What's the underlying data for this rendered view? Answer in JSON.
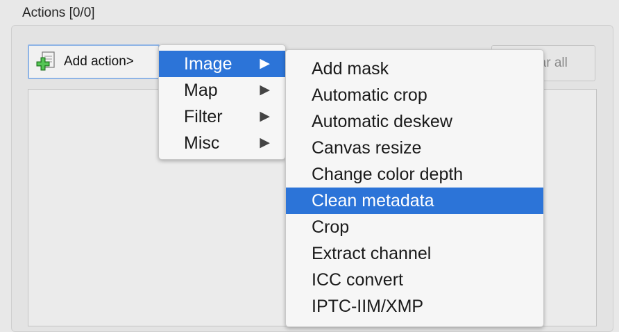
{
  "group": {
    "title": "Actions [0/0]"
  },
  "toolbar": {
    "add_action_label": "Add action>",
    "add_action_icon": "add-document-icon",
    "clear_all_label": "Clear all"
  },
  "menu": {
    "items": [
      {
        "label": "Image",
        "submenu_arrow": "▶",
        "highlighted": true
      },
      {
        "label": "Map",
        "submenu_arrow": "▶"
      },
      {
        "label": "Filter",
        "submenu_arrow": "▶"
      },
      {
        "label": "Misc",
        "submenu_arrow": "▶"
      }
    ]
  },
  "submenu": {
    "items": [
      {
        "label": "Add mask"
      },
      {
        "label": "Automatic crop"
      },
      {
        "label": "Automatic deskew"
      },
      {
        "label": "Canvas resize"
      },
      {
        "label": "Change color depth"
      },
      {
        "label": "Clean metadata",
        "highlighted": true
      },
      {
        "label": "Crop"
      },
      {
        "label": "Extract channel"
      },
      {
        "label": "ICC convert"
      },
      {
        "label": "IPTC-IIM/XMP"
      }
    ]
  },
  "colors": {
    "highlight": "#2c74d8",
    "button_focus_border": "#8eb4e6",
    "icon_green": "#3aa83a"
  }
}
